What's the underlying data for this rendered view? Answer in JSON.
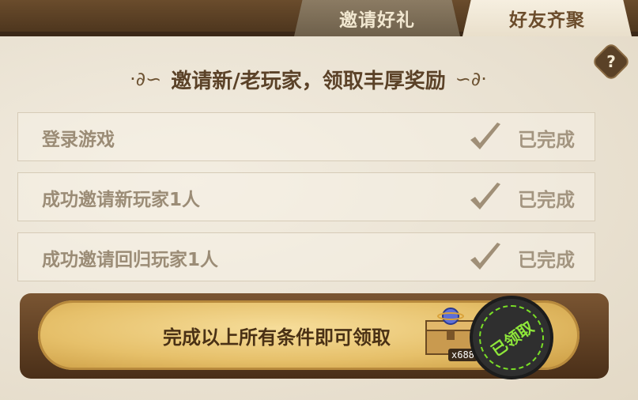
{
  "tabs": [
    {
      "label": "邀请好礼",
      "active": false
    },
    {
      "label": "好友齐聚",
      "active": true
    }
  ],
  "help": {
    "label": "?"
  },
  "headline": "邀请新/老玩家，领取丰厚奖励",
  "tasks": [
    {
      "label": "登录游戏",
      "status": "已完成"
    },
    {
      "label": "成功邀请新玩家1人",
      "status": "已完成"
    },
    {
      "label": "成功邀请回归玩家1人",
      "status": "已完成"
    }
  ],
  "reward": {
    "text": "完成以上所有条件即可领取",
    "item_count": "x688",
    "stamp": "已领取"
  },
  "colors": {
    "accent_brown": "#5b4228",
    "stamp_green": "#8ee63a",
    "gold": "#e6c06a"
  }
}
